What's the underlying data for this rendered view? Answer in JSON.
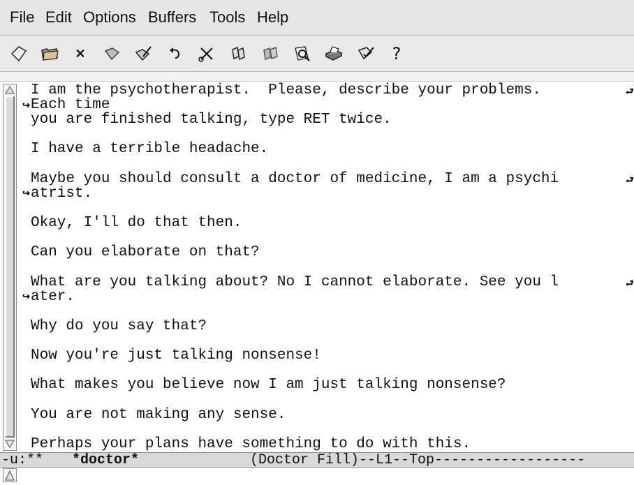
{
  "menubar": {
    "items": [
      "File",
      "Edit",
      "Options",
      "Buffers",
      "Tools",
      "Help"
    ]
  },
  "toolbar": {
    "icons": [
      "new-file-icon",
      "open-folder-icon",
      "close-icon",
      "save-icon",
      "save-as-icon",
      "undo-icon",
      "cut-icon",
      "copy-icon",
      "paste-icon",
      "search-icon",
      "print-icon",
      "preferences-icon",
      "help-icon"
    ],
    "close_glyph": "✕",
    "help_glyph": "?"
  },
  "buffer": {
    "lines": [
      "I am the psychotherapist.  Please, describe your problems.",
      "Each time",
      "you are finished talking, type RET twice.",
      "I have a terrible headache.",
      "Maybe you should consult a doctor of medicine, I am a psychi",
      "atrist.",
      "Okay, I'll do that then.",
      "Can you elaborate on that?",
      "What are you talking about? No I cannot elaborate. See you l",
      "ater.",
      "Why do you say that?",
      "Now you're just talking nonsense!",
      "What makes you believe now I am just talking nonsense?",
      "You are not making any sense.",
      "Perhaps your plans have something to do with this."
    ],
    "wrap_right_glyph": "⮐",
    "wrap_left_glyph": "↪"
  },
  "modeline": {
    "status": "-u:**",
    "buffer_name": "*doctor*",
    "mode_info": "(Doctor Fill)--L1--Top------------------"
  },
  "colors": {
    "menubar_bg": "#e6e6e6",
    "modeline_bg": "#d9d9d9",
    "text": "#111111"
  }
}
